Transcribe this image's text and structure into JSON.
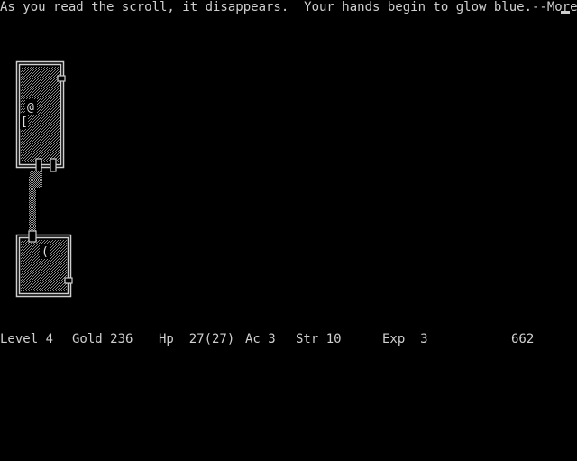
{
  "message": {
    "text": "As you read the scroll, it disappears.  Your hands begin to glow blue.--More--"
  },
  "map": {
    "player_glyph": "@",
    "item_glyph_upper": "[",
    "item_glyph_lower": "(",
    "colors": {
      "wall": "#cfcfcf",
      "floor": "#8a8a8a",
      "corridor": "#9a9a9a",
      "background": "#000000"
    }
  },
  "status": {
    "level_label": "Level 4",
    "gold_label": "Gold 236",
    "hp_label": "Hp  27(27)",
    "ac_label": "Ac 3",
    "str_label": "Str 10",
    "exp_label": "Exp  3",
    "turns": "662"
  }
}
